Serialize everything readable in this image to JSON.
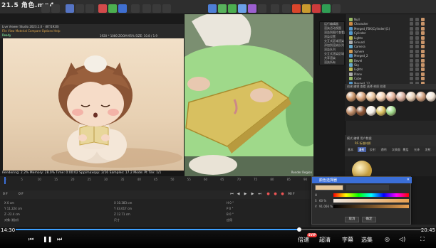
{
  "video_title": "21.5 角色.mp4",
  "render_window": {
    "title": "Live Viewer Studio 2023.1.0 - (87/1920)",
    "menu": "File  View  Material  Compare  Options  Help",
    "info_left": "Ready",
    "resolution_label": "1920 * 1080 ZOOM:95%  SIZE: 10.8 / 1.9",
    "info_panel": [
      "1/7 Ready",
      "Redshift 3.5.19",
      "Live Viewer"
    ],
    "status": "Rendering: 2.2%   Memory: 28.0%   Time: 0:00:02   Spp/maxspp: 2/16   Samples: 17.2   Mode: Pt   Tile: 1/1",
    "scene_colors": {
      "bg": "#efdcc3",
      "hair": "#8a5435",
      "skin": "#f6dcc8",
      "book": "#e8d69a",
      "hat": "#f4efe6"
    }
  },
  "viewport": {
    "label": "Render Region",
    "scene_colors": {
      "bg": "#7b8f71",
      "shirt": "#9fd98a",
      "book": "#d8c060",
      "skin": "#e8c8b0"
    }
  },
  "context_menu": [
    "运行编辑器",
    "渲染活动视图",
    "渲染到图片查看器",
    "渲染设置",
    "交互式区域渲染",
    "添加到渲染队列",
    "渲染队列",
    "交互式渲染区域",
    "共享渲染",
    "渲染所有"
  ],
  "object_manager": {
    "items": [
      {
        "label": "Null",
        "color": "#9b6"
      },
      {
        "label": "Character",
        "color": "#c84"
      },
      {
        "label": "Merged_FBX(Cylinder)(1)",
        "color": "#59c"
      },
      {
        "label": "Cylinder",
        "color": "#59c"
      },
      {
        "label": "Lights",
        "color": "#bb5"
      },
      {
        "label": "Ground",
        "color": "#aaa"
      },
      {
        "label": "Camera",
        "color": "#6ac"
      },
      {
        "label": "Sphere",
        "color": "#c95"
      },
      {
        "label": "Merged_2",
        "color": "#59c"
      },
      {
        "label": "Bevel",
        "color": "#9b6"
      },
      {
        "label": "Sky",
        "color": "#6ac"
      },
      {
        "label": "Lights",
        "color": "#bb5"
      },
      {
        "label": "Plane",
        "color": "#aaa"
      },
      {
        "label": "Cube",
        "color": "#9b6"
      },
      {
        "label": "Merged_12",
        "color": "#59c"
      }
    ]
  },
  "materials": {
    "header": "创建  编辑  查看  选择  材质  纹理",
    "swatches": [
      "#c9956a",
      "#d8a47c",
      "#e8c49e",
      "#f2d0b2",
      "#e6b49c",
      "#d9b0a0",
      "#e8d0b8",
      "#cfa080",
      "#f0e4d6",
      "#bc8a66",
      "#8a5435",
      "#f4efe6",
      "#d8c060",
      "#9fd98a"
    ]
  },
  "attributes": {
    "header": "模式  编辑  用户数据",
    "material_name": "RS 标准材质",
    "tabs": [
      "基本",
      "漫射",
      "反射",
      "透明",
      "次表面",
      "覆层",
      "光泽",
      "发射"
    ],
    "selected_tab": 1
  },
  "color_picker": {
    "title": "颜色选择器",
    "h_label": "H",
    "s_label": "S",
    "v_label": "V",
    "s_value": "60 %",
    "v_value": "91.066 %",
    "cancel_label": "取消",
    "ok_label": "确定"
  },
  "timeline": {
    "ticks": [
      "0",
      "5",
      "10",
      "15",
      "20",
      "25",
      "30",
      "35",
      "40",
      "45",
      "50",
      "55",
      "60",
      "65",
      "70",
      "75",
      "80",
      "85",
      "90"
    ],
    "current_frame": "0 F",
    "end_frame": "90 F",
    "playhead": 0
  },
  "coordinates": {
    "rows": [
      {
        "a": "X  0 cm",
        "b": "X  10.383 cm",
        "c": "H  0 °"
      },
      {
        "a": "Y  11.224 cm",
        "b": "Y  43.017 cm",
        "c": "P  0 °"
      },
      {
        "a": "Z  -22.4 cm",
        "b": "Z  12.71 cm",
        "c": "B  0 °"
      },
      {
        "a": "对象 (相对)",
        "b": "尺寸",
        "c": "应用"
      }
    ]
  },
  "player": {
    "time_current": "14:30",
    "time_total": "20:45",
    "progress": 0.698,
    "svip_label": "SVIP",
    "speed_label": "倍速",
    "quality_label": "超清",
    "subtitle_label": "字幕",
    "episodes_label": "选集"
  }
}
